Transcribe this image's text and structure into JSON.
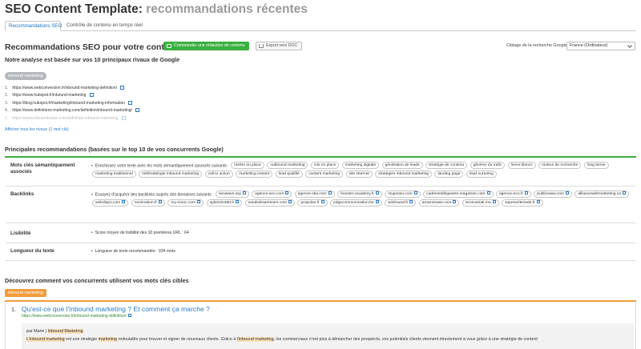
{
  "header": {
    "title": "SEO Content Template:",
    "subtitle": "recommandations récentes"
  },
  "tabs": [
    {
      "label": "Recommandations SEO",
      "active": true
    },
    {
      "label": "Contrôle de contenu en temps réel",
      "active": false
    }
  ],
  "main": {
    "title": "Recommandations SEO pour votre contenu",
    "order_button": "Commander une rédaction de contenu",
    "export_button": "Export vers DOC",
    "targeting_label": "Ciblage de la recherche Google:",
    "targeting_value": "France (Ordinateur)",
    "analysis_title": "Notre analyse est basée sur vos 10 principaux rivaux de Google",
    "keyword_tag": "inbound marketing",
    "urls": [
      {
        "num": "1.",
        "url": "https://www.webconversion.fr/inbound-marketing-definition/"
      },
      {
        "num": "2.",
        "url": "https://www.hubspot.fr/inbound-marketing"
      },
      {
        "num": "3.",
        "url": "https://blog.hubspot.fr/marketing/inbound-marketing-information"
      },
      {
        "num": "4.",
        "url": "https://www.definitions-marketing.com/definition/inbound-marketing/"
      },
      {
        "num": "5.",
        "url": "https://www.inboundvalue.com/definition-inbound-marketing"
      }
    ],
    "show_all": "Afficher tous les rivaux (1 mot clé)"
  },
  "recommendations": {
    "title": "Principales recommandations (basées sur le top 10 de vos concurrents Google)",
    "rows": [
      {
        "label": "Mots clés sémantiquement associés",
        "intro": "Enrichissez votre texte avec les mots sémantiquement associés suivants :",
        "chips": [
          "mettre en place",
          "outbound marketing",
          "mis en place",
          "marketing digitale",
          "génération de leads",
          "stratégie de contenu",
          "générer du trafic",
          "livres blancs",
          "moteur de recherche",
          "long terme",
          "marketing traditionnel",
          "méthodologie inbound marketing",
          "call to action",
          "marketing entrant",
          "lead qualifié",
          "content marketing",
          "site internet",
          "stratégies inbound marketing",
          "landing page",
          "lead nurturing"
        ]
      },
      {
        "label": "Backlinks",
        "intro": "Essayez d'acquérir des backlinks auprès des domaines suivants :",
        "chips": [
          "seowave.org",
          "agence-seo.com",
          "agence-ska.com",
          "booster-academy.fr",
          "myposeo.com",
          "cadresetdirigeants-magazine.com",
          "agence-eco.fr",
          "publicwww.com",
          "alliancewebmarketing.ca",
          "webdispo.com",
          "nomination.fr",
          "my-mooc.com",
          "optimize360.fr",
          "sandsdreamtours.com",
          "propulse.fr",
          "edgecommunication.be",
          "winbound.fr",
          "amazonaws.com",
          "seomaniak.ma",
          "superwriterweb.fr"
        ]
      },
      {
        "label": "Lisibilité",
        "text": "Score moyen de lisibilité des 10 premières URL : 64"
      },
      {
        "label": "Longueur du texte",
        "text": "Longueur de texte recommandée : 934 mots"
      }
    ]
  },
  "competitors": {
    "title": "Découvrez comment vos concurrents utilisent vos mots clés cibles",
    "keyword_tag": "inbound marketing",
    "result": {
      "num": "1.",
      "title": "Qu'est-ce que l'inbound marketing ? Et comment ça marche ?",
      "url": "https://www.webconversion.fr/inbound-marketing-definition/",
      "author_prefix": "par Marie |",
      "author_highlight": "Inbound Marketing",
      "snippet": [
        {
          "t": "L'inbound marketing",
          "hl": true
        },
        {
          "t": " est une stratégie ",
          "hl": false
        },
        {
          "t": "marketing",
          "hl": true
        },
        {
          "t": " redoutable pour trouver et signer de nouveaux clients. Grâce à ",
          "hl": false
        },
        {
          "t": "l'inbound marketing",
          "hl": true
        },
        {
          "t": ", les commerciaux n'ont plus à démarcher des prospects, vos potentiels clients viennent directement à vous grâce à une stratégie de content",
          "hl": false
        }
      ]
    }
  }
}
